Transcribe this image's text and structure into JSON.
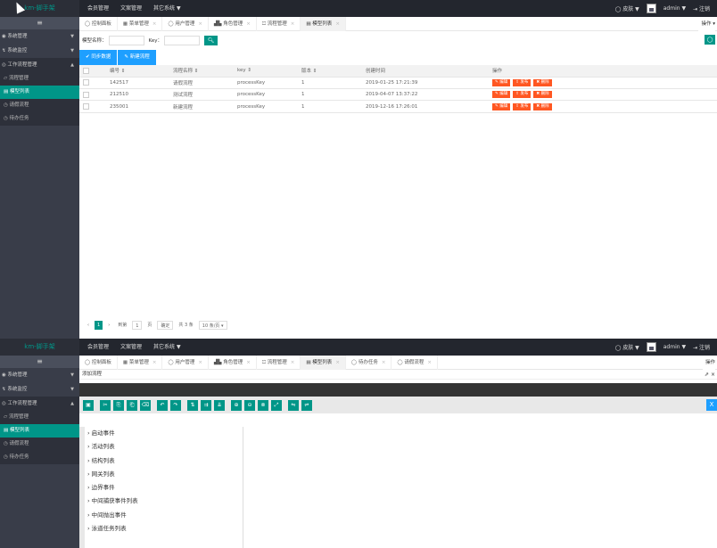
{
  "top": {
    "logo": "km-脚手架",
    "nav": [
      "会员管理",
      "文案管理",
      "其它系统 ▼"
    ],
    "right": [
      "◯ 皮肤 ▼",
      "admin ▼",
      "⇥ 注销"
    ]
  },
  "sidebar1": {
    "toggle": "≡",
    "items": [
      {
        "label": "◉ 系统管理",
        "arrow": "▼"
      },
      {
        "label": "↯ 系统监控",
        "arrow": "▼"
      },
      {
        "label": "◎ 工作流程管理",
        "arrow": "▲"
      }
    ],
    "sub": [
      "▱ 流程管理",
      "▤ 模型列表",
      "◷ 请假流程",
      "◷ 待办任务"
    ]
  },
  "tabs1": [
    {
      "label": "◯ 控制面板",
      "close": ""
    },
    {
      "label": "▦ 菜单管理",
      "close": "×"
    },
    {
      "label": "◯ 用户管理",
      "close": "×"
    },
    {
      "label": "▟▙ 角色管理",
      "close": "×"
    },
    {
      "label": "⏍ 流程管理",
      "close": "×"
    },
    {
      "label": "▤ 模型列表",
      "close": "×"
    }
  ],
  "tabmenu": "操作 ▾",
  "search": {
    "name_label": "模型名称：",
    "key_label": "Key：",
    "button": "🔍︎",
    "refresh": "◯"
  },
  "buttons": [
    "✔ 同步数据",
    "✎ 新建流程"
  ],
  "table": {
    "headers": [
      "",
      "编号 ⇕",
      "流程名称 ⇕",
      "key ⇕",
      "版本 ⇕",
      "创建时间",
      "操作"
    ],
    "rows": [
      {
        "id": "142517",
        "name": "请假流程",
        "key": "processKey",
        "version": "1",
        "time": "2019-01-25 17:21:39"
      },
      {
        "id": "212510",
        "name": "测试流程",
        "key": "processKey",
        "version": "1",
        "time": "2019-04-07 13:37:22"
      },
      {
        "id": "235001",
        "name": "新建流程",
        "key": "processKey",
        "version": "1",
        "time": "2019-12-16 17:26:01"
      }
    ],
    "ops": [
      "✎ 编辑",
      "⇪ 发布",
      "✖ 删除"
    ]
  },
  "pager": {
    "prev": "‹",
    "cur": "1",
    "next": "›",
    "goto": "到第",
    "page": "1",
    "unit": "页",
    "confirm": "确定",
    "total": "共 3 条",
    "size": "10 条/页 ▾"
  },
  "tabs2": [
    {
      "label": "◯ 控制面板",
      "close": ""
    },
    {
      "label": "▦ 菜单管理",
      "close": "×"
    },
    {
      "label": "◯ 用户管理",
      "close": "×"
    },
    {
      "label": "▟▙ 角色管理",
      "close": "×"
    },
    {
      "label": "⏍ 流程管理",
      "close": "×"
    },
    {
      "label": "▤ 模型列表",
      "close": "×"
    },
    {
      "label": "◯ 待办任务",
      "close": "×"
    },
    {
      "label": "◯ 请假流程",
      "close": "×"
    }
  ],
  "tabmenu2": "操作",
  "subtitle": "添加流程",
  "subright": "⇗ ×",
  "toolbar_icons": [
    "▣",
    "✂",
    "⎘",
    "⎗",
    "⌫",
    "↶",
    "↷",
    "⇅",
    "⇉",
    "⇊",
    "⊕",
    "⊖",
    "⊗",
    "⤢",
    "⇋",
    "⇌"
  ],
  "toolbar_close": "X",
  "palette": [
    "› 启动事件",
    "› 活动列表",
    "› 结构列表",
    "› 网关列表",
    "› 边界事件",
    "› 中间捕获事件列表",
    "› 中间抛出事件",
    "› 泳道任务列表"
  ]
}
